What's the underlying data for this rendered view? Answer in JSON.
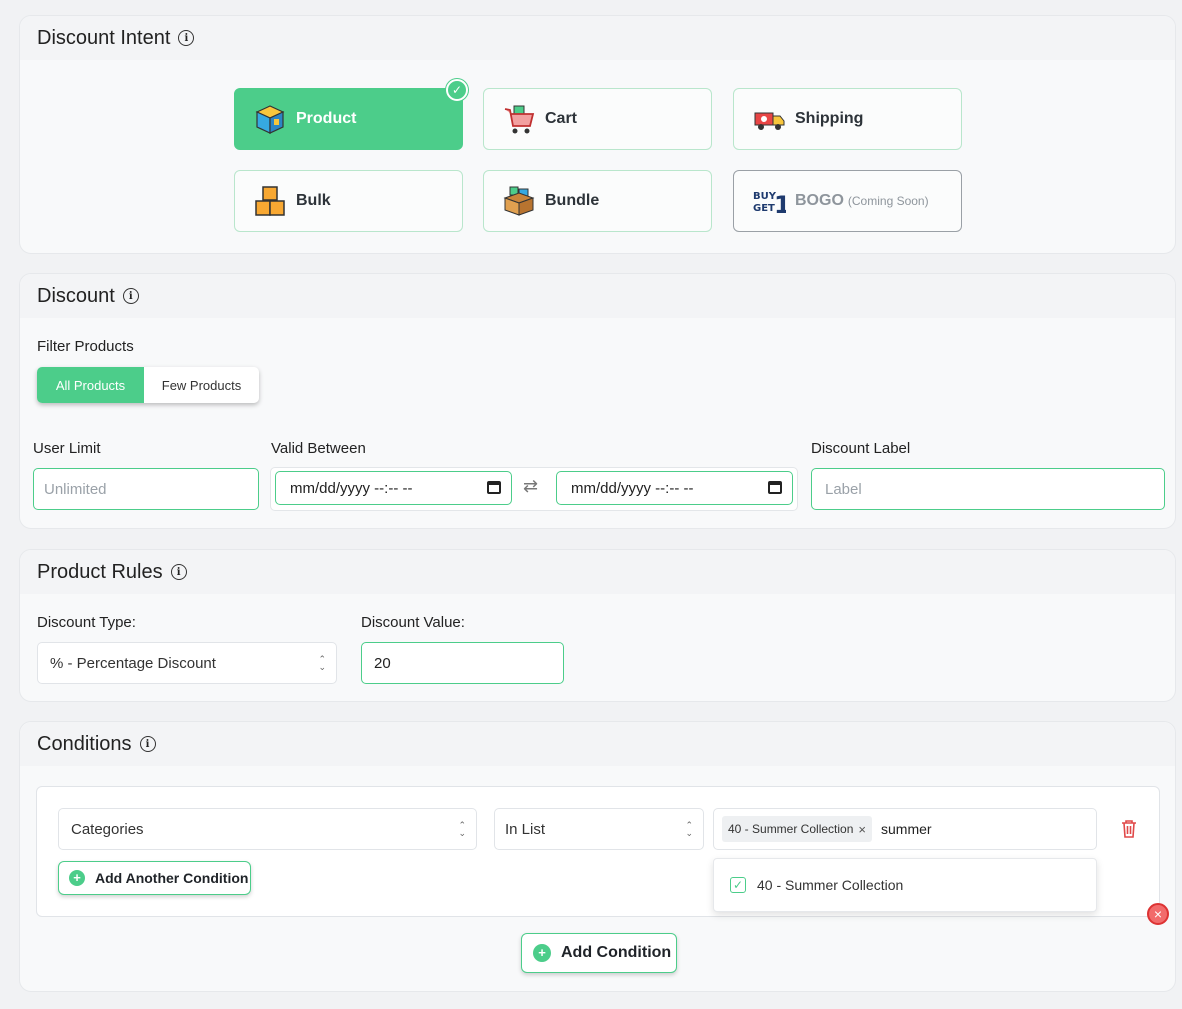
{
  "intent": {
    "title": "Discount Intent",
    "tiles": [
      {
        "label": "Product",
        "icon": "product-box-icon"
      },
      {
        "label": "Cart",
        "icon": "shopping-cart-icon"
      },
      {
        "label": "Shipping",
        "icon": "shipping-truck-icon"
      },
      {
        "label": "Bulk",
        "icon": "stacked-boxes-icon"
      },
      {
        "label": "Bundle",
        "icon": "bundle-box-icon"
      },
      {
        "label": "BOGO",
        "note": "(Coming Soon)",
        "icon": "buy-get-one-icon"
      }
    ],
    "selected": "Product"
  },
  "discount": {
    "title": "Discount",
    "filter_label": "Filter Products",
    "filter_options": [
      "All Products",
      "Few Products"
    ],
    "user_limit_label": "User Limit",
    "user_limit_placeholder": "Unlimited",
    "valid_between_label": "Valid Between",
    "date_start": "mm/dd/yyyy --:-- --",
    "date_end": "mm/dd/yyyy --:-- --",
    "label_label": "Discount Label",
    "label_placeholder": "Label"
  },
  "rules": {
    "title": "Product Rules",
    "type_label": "Discount Type:",
    "type_value": "% - Percentage Discount",
    "value_label": "Discount Value:",
    "value": "20"
  },
  "conditions": {
    "title": "Conditions",
    "field": "Categories",
    "operator": "In List",
    "tag": "40 - Summer Collection",
    "search": "summer",
    "option": "40 - Summer Collection",
    "add_another": "Add Another Condition",
    "add_condition": "Add Condition"
  },
  "colors": {
    "accent": "#4ccd8a",
    "danger": "#e04848"
  }
}
